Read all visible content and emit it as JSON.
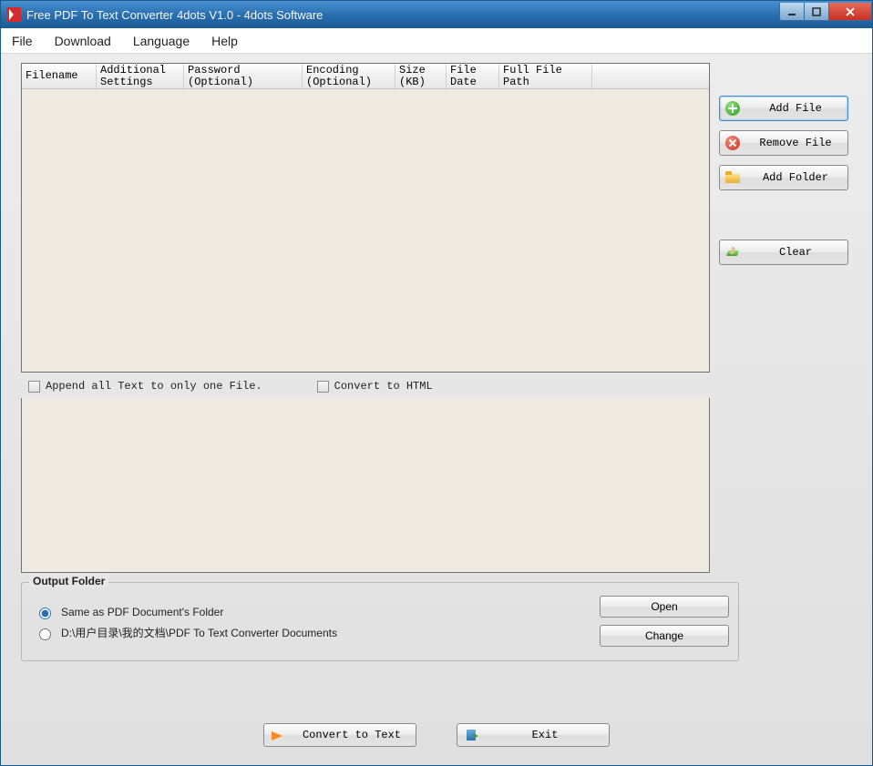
{
  "window": {
    "title": "Free PDF To Text Converter 4dots V1.0 - 4dots Software"
  },
  "menu": {
    "file": "File",
    "download": "Download",
    "language": "Language",
    "help": "Help"
  },
  "grid": {
    "columns": {
      "filename": "Filename",
      "additional_settings": "Additional\nSettings",
      "password": "Password\n(Optional)",
      "encoding": "Encoding\n(Optional)",
      "size": "Size\n(KB)",
      "file_date": "File\nDate",
      "full_path": "Full File\nPath"
    }
  },
  "checkboxes": {
    "append_all": "Append all Text to only one File.",
    "convert_html": "Convert to HTML"
  },
  "side": {
    "add_file": "Add File",
    "remove_file": "Remove File",
    "add_folder": "Add Folder",
    "clear": "Clear"
  },
  "output": {
    "legend": "Output Folder",
    "same_folder": "Same as PDF Document's Folder",
    "custom_path": "D:\\用户目录\\我的文档\\PDF To Text Converter Documents",
    "open": "Open",
    "change": "Change"
  },
  "bottom": {
    "convert": "Convert to Text",
    "exit": "Exit"
  }
}
